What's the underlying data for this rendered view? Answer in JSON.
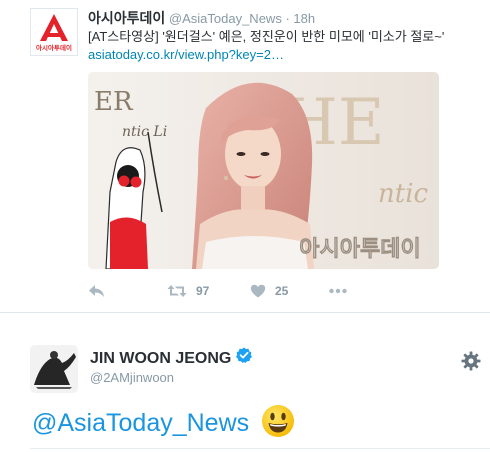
{
  "quoted_tweet": {
    "author_name": "아시아투데이",
    "author_handle": "@AsiaToday_News",
    "separator": "·",
    "time": "18h",
    "logo_caption": "아시아투데이",
    "text": "[AT스타영상] '원더걸스' 예은, 정진운이 반한 미모에 '미소가 절로~'",
    "link": "asiatoday.co.kr/view.php?key=2…",
    "media_watermark": "아시아투데이",
    "media_backdrop_letters": [
      "ER",
      "HE",
      "ntic",
      "ntic Li"
    ],
    "actions": {
      "reply_count": "",
      "retweet_count": "97",
      "like_count": "25"
    }
  },
  "user_tweet": {
    "display_name": "JIN WOON JEONG",
    "handle": "@2AMjinwoon",
    "mention": "@AsiaToday_News"
  },
  "colors": {
    "brand_red": "#e4222b",
    "link_blue": "#0084b4",
    "mention_blue": "#1b95e0",
    "verified_blue": "#1da1f2",
    "muted_gray": "#8899a6",
    "icon_gray": "#aab8c2"
  },
  "icons": {
    "reply": "reply-icon",
    "retweet": "retweet-icon",
    "like": "heart-icon",
    "more": "more-dots-icon",
    "verified": "verified-badge-icon",
    "settings": "gear-icon",
    "emoji": "smiley-emoji-icon"
  }
}
